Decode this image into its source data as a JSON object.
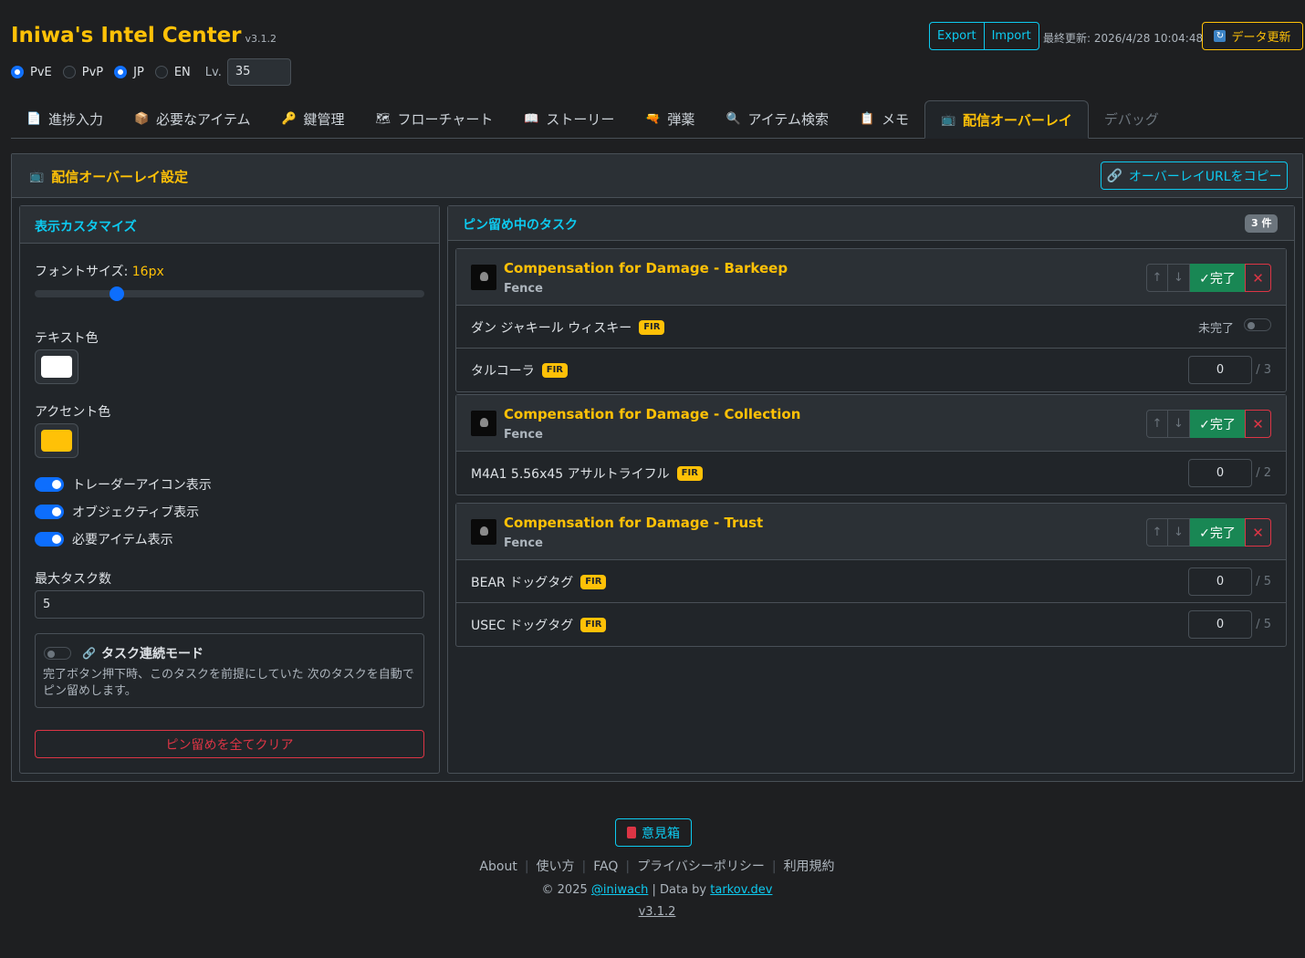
{
  "app": {
    "title": "Iniwa's Intel Center",
    "version": "v3.1.2"
  },
  "mode_options": [
    {
      "label": "PvE",
      "selected": true
    },
    {
      "label": "PvP",
      "selected": false
    }
  ],
  "lang_options": [
    {
      "label": "JP",
      "selected": true
    },
    {
      "label": "EN",
      "selected": false
    }
  ],
  "level": {
    "label": "Lv.",
    "value": "35"
  },
  "toolbar": {
    "export_label": "Export",
    "import_label": "Import",
    "last_updated": "最終更新: 2026/4/28 10:04:48",
    "refresh_label": "データ更新"
  },
  "tabs": [
    {
      "icon": "📄",
      "label": "進捗入力"
    },
    {
      "icon": "📦",
      "label": "必要なアイテム"
    },
    {
      "icon": "🔑",
      "label": "鍵管理"
    },
    {
      "icon": "🗺",
      "label": "フローチャート"
    },
    {
      "icon": "📖",
      "label": "ストーリー"
    },
    {
      "icon": "🔫",
      "label": "弾薬"
    },
    {
      "icon": "🔍",
      "label": "アイテム検索"
    },
    {
      "icon": "📋",
      "label": "メモ"
    },
    {
      "icon": "📺",
      "label": "配信オーバーレイ",
      "active": true
    },
    {
      "icon": "",
      "label": "デバッグ"
    }
  ],
  "overlay": {
    "title": "配信オーバーレイ設定",
    "copy_url_label": "オーバーレイURLをコピー",
    "customize": {
      "title": "表示カスタマイズ",
      "font_size_label": "フォントサイズ:",
      "font_size_value": "16px",
      "font_size_fraction": 0.2,
      "text_color_label": "テキスト色",
      "text_color": "#ffffff",
      "accent_color_label": "アクセント色",
      "accent_color": "#ffc107",
      "toggles": [
        {
          "label": "トレーダーアイコン表示",
          "on": true
        },
        {
          "label": "オブジェクティブ表示",
          "on": true
        },
        {
          "label": "必要アイテム表示",
          "on": true
        }
      ],
      "max_tasks_label": "最大タスク数",
      "max_tasks_value": "5",
      "chain_mode_title": "タスク連続モード",
      "chain_mode_desc": "完了ボタン押下時、このタスクを前提にしていた 次のタスクを自動でピン留めします。",
      "clear_label": "ピン留めを全てクリア"
    },
    "pinned": {
      "title": "ピン留め中のタスク",
      "count_label": "3 件",
      "done_label": "✓完了",
      "fir_label": "FIR",
      "tasks": [
        {
          "title": "Compensation for Damage - Barkeep",
          "trader": "Fence",
          "objectives": [
            {
              "name": "ダン ジャキール ウィスキー",
              "fir": true,
              "status": "未完了"
            },
            {
              "name": "タルコーラ",
              "fir": true,
              "value": "0",
              "total": "/ 3"
            }
          ]
        },
        {
          "title": "Compensation for Damage - Collection",
          "trader": "Fence",
          "objectives": [
            {
              "name": "M4A1 5.56x45 アサルトライフル",
              "fir": true,
              "value": "0",
              "total": "/ 2"
            }
          ]
        },
        {
          "title": "Compensation for Damage - Trust",
          "trader": "Fence",
          "objectives": [
            {
              "name": "BEAR ドッグタグ",
              "fir": true,
              "value": "0",
              "total": "/ 5"
            },
            {
              "name": "USEC ドッグタグ",
              "fir": true,
              "value": "0",
              "total": "/ 5"
            }
          ]
        }
      ]
    }
  },
  "footer": {
    "feedback_label": "意見箱",
    "links": [
      "About",
      "使い方",
      "FAQ",
      "プライバシーポリシー",
      "利用規約"
    ],
    "copyright_prefix": "© 2025",
    "author": "@iniwach",
    "data_by": "| Data by",
    "data_source": "tarkov.dev",
    "version": "v3.1.2"
  }
}
